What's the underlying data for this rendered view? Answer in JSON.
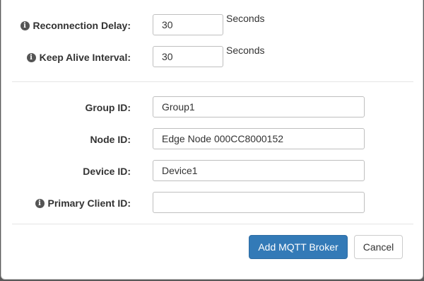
{
  "form": {
    "reconnection_delay": {
      "label": "Reconnection Delay:",
      "value": "30",
      "unit": "Seconds",
      "icon": "info-icon"
    },
    "keep_alive": {
      "label": "Keep Alive Interval:",
      "value": "30",
      "unit": "Seconds",
      "icon": "info-icon"
    },
    "group_id": {
      "label": "Group ID:",
      "value": "Group1"
    },
    "node_id": {
      "label": "Node ID:",
      "value": "Edge Node 000CC8000152"
    },
    "device_id": {
      "label": "Device ID:",
      "value": "Device1"
    },
    "primary_client_id": {
      "label": "Primary Client ID:",
      "value": "",
      "icon": "info-icon"
    }
  },
  "footer": {
    "add_label": "Add MQTT Broker",
    "cancel_label": "Cancel"
  },
  "icons": {
    "info_glyph": "i"
  },
  "colors": {
    "primary": "#337ab7",
    "overlay": "#5a5a5a"
  }
}
